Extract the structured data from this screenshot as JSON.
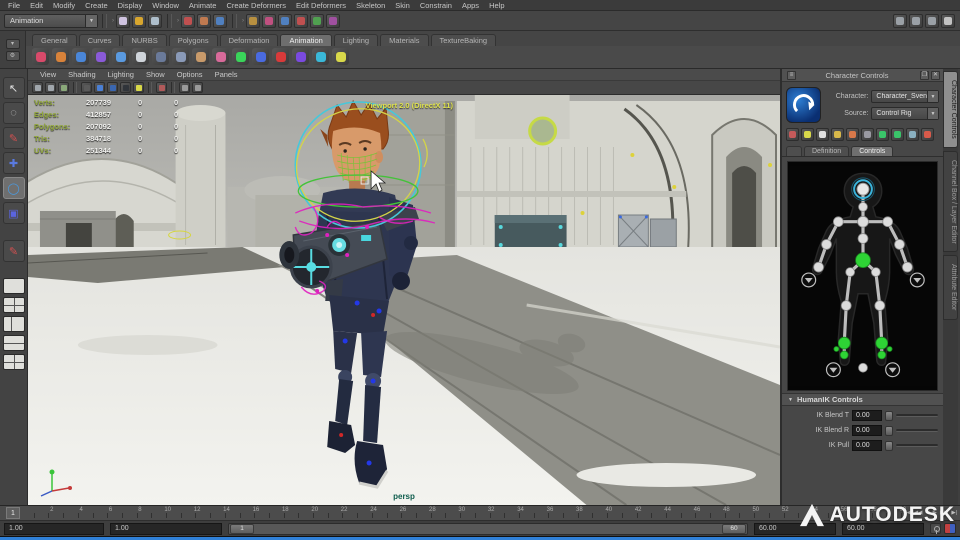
{
  "menu_bar": {
    "items": [
      "File",
      "Edit",
      "Modify",
      "Create",
      "Display",
      "Window",
      "Animate",
      "Create Deformers",
      "Edit Deformers",
      "Skeleton",
      "Skin",
      "Constrain",
      "Apps",
      "Help"
    ]
  },
  "status_line": {
    "menuset": "Animation",
    "groups": [
      {
        "name": "file-group",
        "icons": [
          {
            "name": "new-scene-icon",
            "color": "#cfc3e0"
          },
          {
            "name": "open-scene-icon",
            "color": "#d8a62e"
          },
          {
            "name": "save-scene-icon",
            "color": "#aebecb"
          }
        ]
      },
      {
        "name": "selection-group",
        "icons": [
          {
            "name": "select-hierarchy-icon",
            "color": "#c05050"
          },
          {
            "name": "select-object-icon",
            "color": "#c07a50"
          },
          {
            "name": "select-component-icon",
            "color": "#5080c0"
          }
        ]
      },
      {
        "name": "snap-group",
        "icons": [
          {
            "name": "snap-grid-icon",
            "color": "#b89040"
          },
          {
            "name": "snap-curve-icon",
            "color": "#c05080"
          },
          {
            "name": "snap-point-icon",
            "color": "#5080c0"
          },
          {
            "name": "snap-view-plane-icon",
            "color": "#c05050"
          },
          {
            "name": "make-live-icon",
            "color": "#50a050"
          },
          {
            "name": "construction-history-icon",
            "color": "#a050a0"
          }
        ]
      }
    ],
    "right_toggles": [
      {
        "name": "toggle-attribute-editor-icon",
        "color": "#9aa0a6"
      },
      {
        "name": "toggle-tool-settings-icon",
        "color": "#9aa0a6"
      },
      {
        "name": "toggle-channel-box-icon",
        "color": "#9aa0a6"
      },
      {
        "name": "toggle-character-controls-icon",
        "color": "#c2c2c2"
      }
    ]
  },
  "shelf": {
    "tabs": [
      {
        "label": "General"
      },
      {
        "label": "Curves"
      },
      {
        "label": "NURBS"
      },
      {
        "label": "Polygons"
      },
      {
        "label": "Deformation"
      },
      {
        "label": "Animation",
        "active": true
      },
      {
        "label": "Lighting"
      },
      {
        "label": "Materials"
      },
      {
        "label": "TextureBaking"
      }
    ],
    "icons": [
      {
        "name": "shelf-set-key-icon",
        "color": "#d84a6a"
      },
      {
        "name": "shelf-set-breakdown-icon",
        "color": "#d8823a"
      },
      {
        "name": "shelf-ik-handle-icon",
        "color": "#4a86d8"
      },
      {
        "name": "shelf-spline-ik-icon",
        "color": "#8a5ad8"
      },
      {
        "name": "shelf-joint-tool-icon",
        "color": "#5a9ae0"
      },
      {
        "name": "shelf-ik-spline-handle-icon",
        "color": "#cfd4da"
      },
      {
        "name": "shelf-skeleton-icon",
        "color": "#6a7a9a"
      },
      {
        "name": "shelf-mirror-joint-icon",
        "color": "#8a9ab8"
      },
      {
        "name": "shelf-character-icon",
        "color": "#c89a6a"
      },
      {
        "name": "shelf-paint-weights-icon",
        "color": "#d86a9a"
      },
      {
        "name": "shelf-motion-path-icon",
        "color": "#3ad45a"
      },
      {
        "name": "shelf-constraint-icon",
        "color": "#4a6ae0"
      },
      {
        "name": "shelf-playblast-icon",
        "color": "#d83a3a"
      },
      {
        "name": "shelf-turntable-icon",
        "color": "#7a4ae0"
      },
      {
        "name": "shelf-bake-simulation-icon",
        "color": "#3ab8d8"
      },
      {
        "name": "shelf-ghost-icon",
        "color": "#d8d84a"
      }
    ]
  },
  "toolbox": {
    "tools": [
      {
        "name": "select-tool-icon",
        "color": "#e0e0e0",
        "glyph": "↖"
      },
      {
        "name": "lasso-tool-icon",
        "color": "#c8c8c8",
        "glyph": "◌"
      },
      {
        "name": "paint-select-tool-icon",
        "color": "#d05050",
        "glyph": "✎"
      },
      {
        "name": "move-tool-icon",
        "color": "#5a7ae0",
        "glyph": "✚"
      },
      {
        "name": "rotate-tool-icon",
        "color": "#4a9ae0",
        "glyph": "◯",
        "active": true
      },
      {
        "name": "scale-tool-icon",
        "color": "#5a64e0",
        "glyph": "▣"
      },
      {
        "name": "last-tool-icon",
        "color": "#d05050",
        "glyph": "✎"
      }
    ],
    "layouts": [
      {
        "name": "layout-single-pane-button",
        "kind": "single"
      },
      {
        "name": "layout-four-pane-button",
        "kind": "quad"
      },
      {
        "name": "layout-persp-outliner-button",
        "kind": "vsplit"
      },
      {
        "name": "layout-top-persp-button",
        "kind": "hsplit"
      },
      {
        "name": "layout-quad-alt-button",
        "kind": "quad"
      }
    ]
  },
  "viewport": {
    "menu": [
      "View",
      "Shading",
      "Lighting",
      "Show",
      "Options",
      "Panels"
    ],
    "icons": [
      {
        "name": "vp-select-camera-icon",
        "color": "#a0a6ac"
      },
      {
        "name": "vp-camera-attributes-icon",
        "color": "#a0a6ac"
      },
      {
        "name": "vp-bookmarks-icon",
        "color": "#8aa87a"
      },
      {
        "name": "vp-separator",
        "sep": true
      },
      {
        "name": "vp-wireframe-icon",
        "color": "#5a5a5a"
      },
      {
        "name": "vp-shaded-icon",
        "color": "#4a7fd4"
      },
      {
        "name": "vp-textured-icon",
        "color": "#3a66b0"
      },
      {
        "name": "vp-use-all-lights-icon",
        "color": "#30343a"
      },
      {
        "name": "vp-default-light-icon",
        "color": "#d8d848"
      },
      {
        "name": "vp-separator-2",
        "sep": true
      },
      {
        "name": "vp-isolate-select-icon",
        "color": "#b05a5a"
      },
      {
        "name": "vp-separator-3",
        "sep": true
      },
      {
        "name": "vp-xray-icon",
        "color": "#9a9a9a"
      },
      {
        "name": "vp-xray-joints-icon",
        "color": "#9a9a9a"
      }
    ],
    "overlay_label": "Viewport 2.0 (DirectX 11)",
    "camera_label": "persp",
    "hud_rows": [
      {
        "label": "Verts:",
        "value": "207739",
        "col2": "0",
        "col3": "0"
      },
      {
        "label": "Edges:",
        "value": "412857",
        "col2": "0",
        "col3": "0"
      },
      {
        "label": "Polygons:",
        "value": "207092",
        "col2": "0",
        "col3": "0"
      },
      {
        "label": "Tris:",
        "value": "384718",
        "col2": "0",
        "col3": "0"
      },
      {
        "label": "UVs:",
        "value": "251344",
        "col2": "0",
        "col3": "0"
      }
    ]
  },
  "character_controls": {
    "title": "Character Controls",
    "character_label": "Character:",
    "character_value": "Character_Sven",
    "source_label": "Source:",
    "source_value": "Control Rig",
    "icons": [
      {
        "name": "cc-select-all-icon",
        "color": "#c45a5a"
      },
      {
        "name": "cc-pencil-icon",
        "color": "#d8d84a"
      },
      {
        "name": "cc-stance-pose-icon",
        "color": "#e0e0e0"
      },
      {
        "name": "cc-body-part-icon",
        "color": "#d8b84a"
      },
      {
        "name": "cc-mirror-icon",
        "color": "#d8784a"
      },
      {
        "name": "cc-ghost-icon",
        "color": "#9a9aa2"
      },
      {
        "name": "cc-add-keyframe-icon",
        "color": "#3ac46a"
      },
      {
        "name": "cc-swap-icon",
        "color": "#3ac46a"
      },
      {
        "name": "cc-pin-icon",
        "color": "#8ab0c0"
      },
      {
        "name": "cc-full-body-icon",
        "color": "#d85a4a"
      }
    ],
    "tabs": [
      {
        "label": "",
        "stub": true
      },
      {
        "label": "Definition"
      },
      {
        "label": "Controls",
        "active": true
      }
    ],
    "humanik": {
      "title": "HumanIK Controls",
      "fields": [
        {
          "label": "IK Blend T",
          "value": "0.00"
        },
        {
          "label": "IK Blend R",
          "value": "0.00"
        },
        {
          "label": "IK Pull",
          "value": "0.00"
        }
      ]
    }
  },
  "side_tabs": [
    {
      "label": "Character Controls",
      "active": true
    },
    {
      "label": "Channel Box / Layer Editor"
    },
    {
      "label": "Attribute Editor"
    }
  ],
  "timeline": {
    "current": "1",
    "start": 1,
    "end": 60,
    "label_step": 2
  },
  "playback": {
    "buttons": [
      {
        "name": "go-to-start-button",
        "glyph": "|◀"
      },
      {
        "name": "step-back-button",
        "glyph": "◀◀"
      },
      {
        "name": "play-backwards-button",
        "glyph": "◀"
      },
      {
        "name": "play-forwards-button",
        "glyph": "▶"
      },
      {
        "name": "step-forward-button",
        "glyph": "▶▶"
      },
      {
        "name": "go-to-end-button",
        "glyph": "▶|"
      }
    ]
  },
  "range_slider": {
    "anim_start": "1.00",
    "play_start": "1.00",
    "range_start": "1",
    "range_end": "60",
    "play_end": "60.00",
    "anim_end": "60.00"
  },
  "watermark": {
    "text": "AUTODESK"
  },
  "colors": {
    "bottom_bar_blue": "#2f80d8",
    "hud_label_green": "#93a93c",
    "viewport_label_yellow": "#dde04c",
    "camera_label_teal": "#0d5c4c",
    "manipulator_cyan": "#46c8da",
    "manipulator_green": "#44c23a",
    "manipulator_yellow": "#d4d448",
    "selection_magenta": "#e020c0",
    "joint_green": "#2ed435",
    "joint_ring_cyan": "#3ab4dc"
  }
}
